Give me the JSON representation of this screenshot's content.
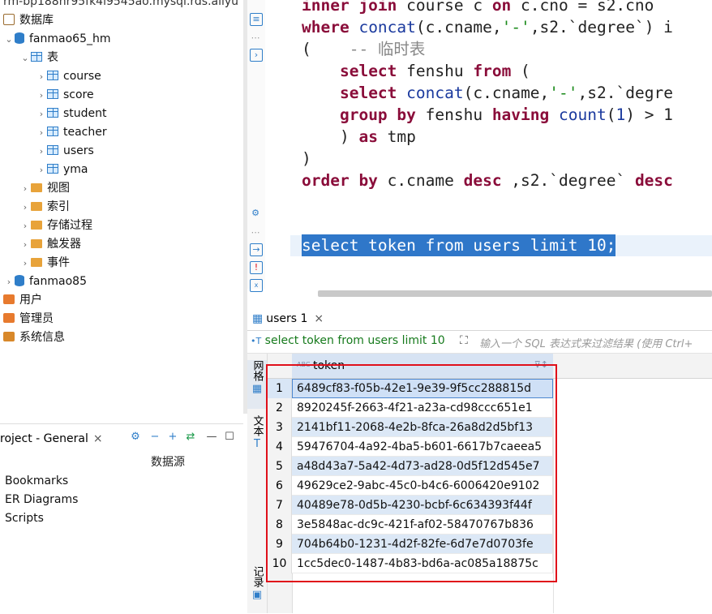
{
  "navigator": {
    "connection_title": "rm-bp188hr95fk4l9545ao.mysql.rds.aliyu",
    "databases_label": "数据库",
    "schema_name": "fanmao65_hm",
    "tables_folder": "表",
    "tables": [
      "course",
      "score",
      "student",
      "teacher",
      "users",
      "yma"
    ],
    "folders": [
      "视图",
      "索引",
      "存储过程",
      "触发器",
      "事件"
    ],
    "other_schema": "fanmao85",
    "users_label": "用户",
    "admins_label": "管理员",
    "sysinfo_label": "系统信息"
  },
  "project_panel": {
    "tab_label": "roject - General",
    "column_header": "数据源",
    "items": [
      "Bookmarks",
      "ER Diagrams",
      "Scripts"
    ]
  },
  "editor": {
    "sql_lines": {
      "l1": [
        "inner join",
        " course c ",
        "on",
        " c.cno = s2.cno"
      ],
      "l2": [
        "where",
        " ",
        "concat",
        "(c.cname,",
        "'-'",
        ",s2.`degree`) i"
      ],
      "l3": [
        "(",
        "    -- 临时表"
      ],
      "l4": [
        "    ",
        "select",
        " fenshu ",
        "from",
        " ("
      ],
      "l5": [
        "    ",
        "select",
        " ",
        "concat",
        "(c.cname,",
        "'-'",
        ",s2.`degre"
      ],
      "l6": [
        "    ",
        "group by",
        " fenshu ",
        "having",
        " ",
        "count",
        "(",
        "1",
        ") > 1"
      ],
      "l7": [
        "    ) ",
        "as",
        " tmp"
      ],
      "l8": [
        ")"
      ],
      "l9": [
        "order by",
        " c.cname ",
        "desc",
        " ,s2.`degree` ",
        "desc"
      ],
      "selected": "select token from users limit 10;"
    }
  },
  "results": {
    "tab_label": "users 1",
    "query_text": "select token from users limit 10",
    "filter_placeholder": "输入一个 SQL 表达式来过滤结果 (使用 Ctrl+",
    "vertical_tabs": [
      "网格",
      "文本",
      "记录"
    ],
    "column_header": "token",
    "rows": [
      {
        "n": "1",
        "token": "6489cf83-f05b-42e1-9e39-9f5cc288815d"
      },
      {
        "n": "2",
        "token": "8920245f-2663-4f21-a23a-cd98ccc651e1"
      },
      {
        "n": "3",
        "token": "2141bf11-2068-4e2b-8fca-26a8d2d5bf13"
      },
      {
        "n": "4",
        "token": "59476704-4a92-4ba5-b601-6617b7caeea5"
      },
      {
        "n": "5",
        "token": "a48d43a7-5a42-4d73-ad28-0d5f12d545e7"
      },
      {
        "n": "6",
        "token": "49629ce2-9abc-45c0-b4c6-6006420e9102"
      },
      {
        "n": "7",
        "token": "40489e78-0d5b-4230-bcbf-6c634393f44f"
      },
      {
        "n": "8",
        "token": "3e5848ac-dc9c-421f-af02-58470767b836"
      },
      {
        "n": "9",
        "token": "704b64b0-1231-4d2f-82fe-6d7e7d0703fe"
      },
      {
        "n": "10",
        "token": "1cc5dec0-1487-4b83-bd6a-ac085a18875c"
      }
    ]
  },
  "colors": {
    "selection": "#2f77c9",
    "keyword": "#8a0d3a",
    "highlight_box": "#e0101a"
  }
}
